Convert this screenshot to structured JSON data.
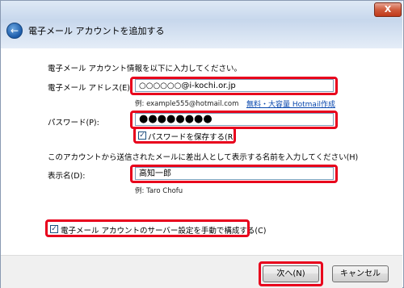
{
  "window": {
    "title": "電子メール アカウントを追加する",
    "close_label": "X"
  },
  "form": {
    "intro": "電子メール アカウント情報を以下に入力してください。",
    "email_label": "電子メール アドレス(E):",
    "email_value": "○○○○○○@i-kochi.or.jp",
    "email_example": "例: example555@hotmail.com",
    "hotmail_link": "無料・大容量 Hotmail作成",
    "password_label": "パスワード(P):",
    "password_value": "●●●●●●●●",
    "save_password_label": "パスワードを保存する(R)",
    "display_name_intro": "このアカウントから送信されたメールに差出人として表示する名前を入力してください(H)",
    "display_name_label": "表示名(D):",
    "display_name_value": "高知一郎",
    "display_name_example": "例: Taro Chofu",
    "manual_config_label": "電子メール アカウントのサーバー設定を手動で構成する(C)"
  },
  "checkboxes": {
    "save_password": true,
    "manual_config": true
  },
  "footer": {
    "next_label": "次へ(N)",
    "cancel_label": "キャンセル"
  },
  "colors": {
    "highlight": "#e8001c",
    "link": "#0645ad"
  }
}
